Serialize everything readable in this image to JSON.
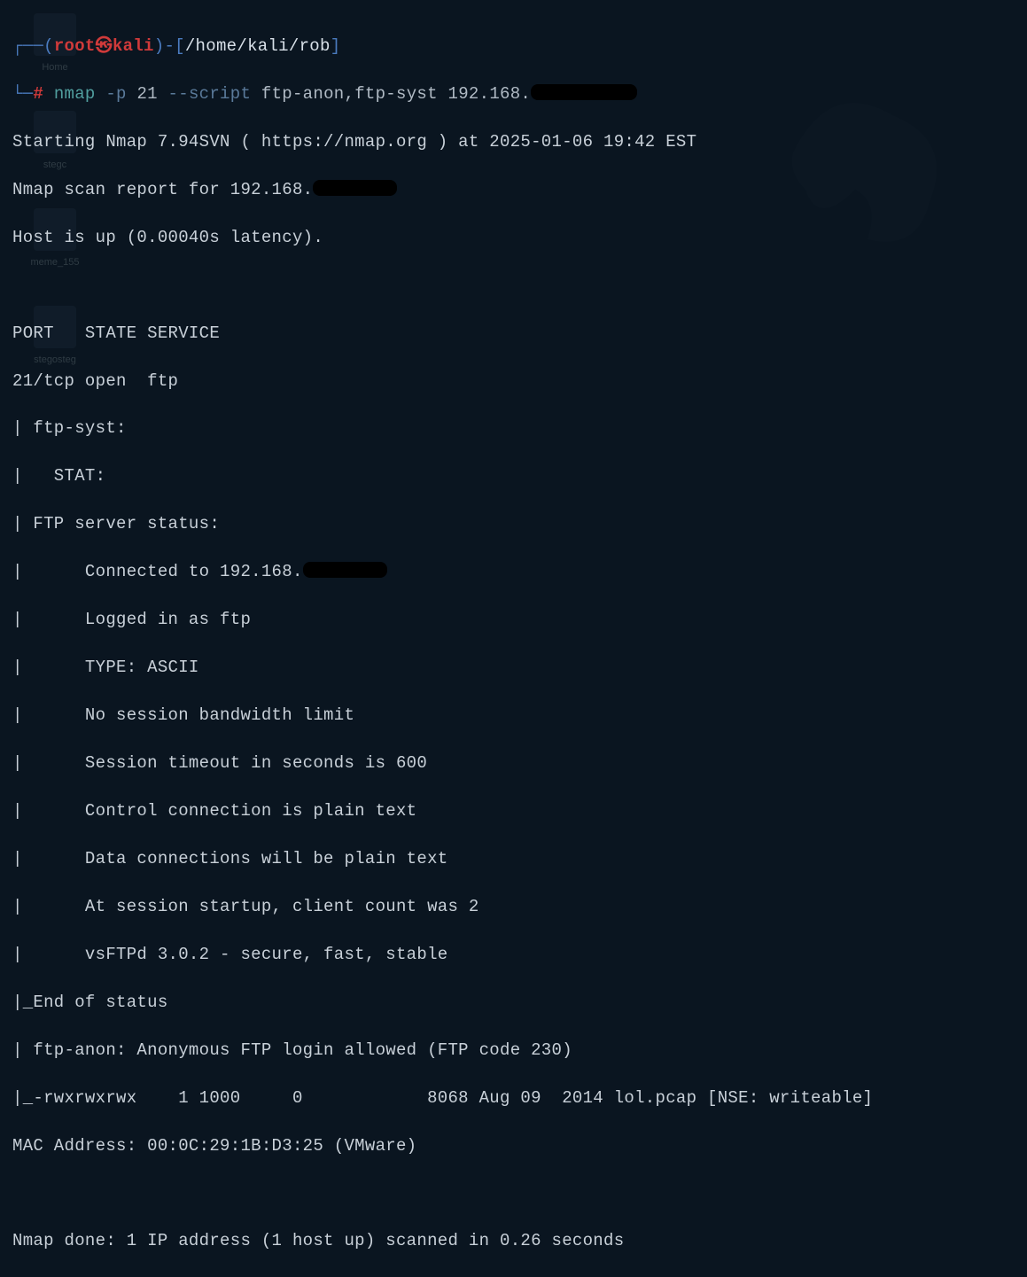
{
  "prompt": {
    "lbracket_top": "┌──(",
    "user": "root",
    "skull": "㉿",
    "host": "kali",
    "rparen": ")-[",
    "path": "/home/kali/rob",
    "rbracket": "]",
    "lbracket_bot": "└─",
    "hash": "#"
  },
  "command": {
    "cmd": "nmap",
    "flag_p": "-p",
    "port": "21",
    "flag_script": "--script",
    "scripts": "ftp-anon,ftp-syst",
    "target_prefix": "192.168."
  },
  "output": {
    "l1a": "Starting Nmap 7.94SVN ( https://nmap.org ) at 2025-01-06 19:42 EST",
    "l2a": "Nmap scan report for 192.168.",
    "l3": "Host is up (0.00040s latency).",
    "l4": "",
    "l5": "PORT   STATE SERVICE",
    "l6": "21/tcp open  ftp",
    "l7": "| ftp-syst: ",
    "l8": "|   STAT: ",
    "l9": "| FTP server status:",
    "l10a": "|      Connected to 192.168.",
    "l11": "|      Logged in as ftp",
    "l12": "|      TYPE: ASCII",
    "l13": "|      No session bandwidth limit",
    "l14": "|      Session timeout in seconds is 600",
    "l15": "|      Control connection is plain text",
    "l16": "|      Data connections will be plain text",
    "l17": "|      At session startup, client count was 2",
    "l18": "|      vsFTPd 3.0.2 - secure, fast, stable",
    "l19": "|_End of status",
    "l20": "| ftp-anon: Anonymous FTP login allowed (FTP code 230)",
    "l21": "|_-rwxrwxrwx    1 1000     0            8068 Aug 09  2014 lol.pcap [NSE: writeable]",
    "l22": "MAC Address: 00:0C:29:1B:D3:25 (VMware)",
    "l23": "",
    "l24": "Nmap done: 1 IP address (1 host up) scanned in 0.26 seconds"
  },
  "desktop": {
    "icon1": "Home",
    "icon2": "stegc",
    "icon3": "meme_155",
    "icon4": "stegosteg"
  }
}
